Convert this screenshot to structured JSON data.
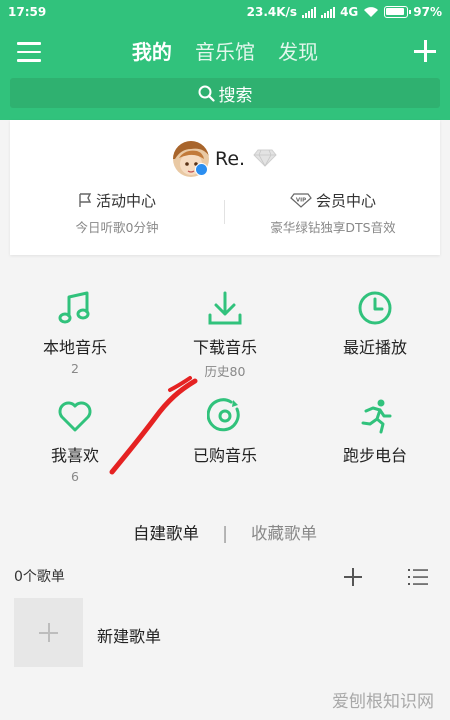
{
  "status_bar": {
    "time": "17:59",
    "speed": "23.4K/s",
    "network": "4G",
    "battery": "97%"
  },
  "nav": {
    "tabs": [
      "我的",
      "音乐馆",
      "发现"
    ],
    "active": 0
  },
  "search": {
    "placeholder": "搜索"
  },
  "profile": {
    "name": "Re."
  },
  "activity": {
    "title": "活动中心",
    "subtitle": "今日听歌0分钟"
  },
  "membership": {
    "title": "会员中心",
    "subtitle": "豪华绿钻独享DTS音效",
    "badge": "VIP"
  },
  "grid": [
    {
      "label": "本地音乐",
      "sub": "2",
      "icon": "music-note-icon"
    },
    {
      "label": "下载音乐",
      "sub": "历史80",
      "icon": "download-icon"
    },
    {
      "label": "最近播放",
      "sub": "",
      "icon": "clock-icon"
    },
    {
      "label": "我喜欢",
      "sub": "6",
      "icon": "heart-icon"
    },
    {
      "label": "已购音乐",
      "sub": "",
      "icon": "purchased-disc-icon"
    },
    {
      "label": "跑步电台",
      "sub": "",
      "icon": "running-icon"
    }
  ],
  "playlist_tabs": {
    "created": "自建歌单",
    "separator": "|",
    "collected": "收藏歌单"
  },
  "playlists": {
    "count_label": "0个歌单",
    "new_label": "新建歌单"
  },
  "watermark": "爱刨根知识网",
  "colors": {
    "brand": "#31c27c",
    "annotation": "#e52222"
  }
}
